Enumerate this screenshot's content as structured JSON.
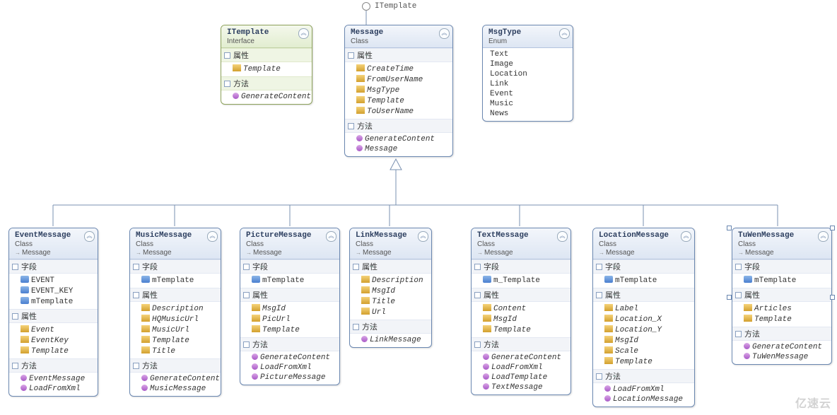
{
  "interface_label": "ITemplate",
  "sections": {
    "properties": "属性",
    "methods": "方法",
    "fields": "字段"
  },
  "watermark": "亿速云",
  "classes": {
    "ITemplate": {
      "name": "ITemplate",
      "sub": "Interface",
      "properties": [
        "Template"
      ],
      "methods": [
        "GenerateContent"
      ]
    },
    "Message": {
      "name": "Message",
      "sub": "Class",
      "properties": [
        "CreateTime",
        "FromUserName",
        "MsgType",
        "Template",
        "ToUserName"
      ],
      "methods": [
        "GenerateContent",
        "Message"
      ]
    },
    "MsgType": {
      "name": "MsgType",
      "sub": "Enum",
      "values": [
        "Text",
        "Image",
        "Location",
        "Link",
        "Event",
        "Music",
        "News"
      ]
    },
    "EventMessage": {
      "name": "EventMessage",
      "sub": "Class",
      "inherits": "Message",
      "fields": [
        "EVENT",
        "EVENT_KEY",
        "mTemplate"
      ],
      "properties": [
        "Event",
        "EventKey",
        "Template"
      ],
      "methods": [
        "EventMessage",
        "LoadFromXml"
      ]
    },
    "MusicMessage": {
      "name": "MusicMessage",
      "sub": "Class",
      "inherits": "Message",
      "fields": [
        "mTemplate"
      ],
      "properties": [
        "Description",
        "HQMusicUrl",
        "MusicUrl",
        "Template",
        "Title"
      ],
      "methods": [
        "GenerateContent",
        "MusicMessage"
      ]
    },
    "PictureMessage": {
      "name": "PictureMessage",
      "sub": "Class",
      "inherits": "Message",
      "fields": [
        "mTemplate"
      ],
      "properties": [
        "MsgId",
        "PicUrl",
        "Template"
      ],
      "methods": [
        "GenerateContent",
        "LoadFromXml",
        "PictureMessage"
      ]
    },
    "LinkMessage": {
      "name": "LinkMessage",
      "sub": "Class",
      "inherits": "Message",
      "properties": [
        "Description",
        "MsgId",
        "Title",
        "Url"
      ],
      "methods": [
        "LinkMessage"
      ]
    },
    "TextMessage": {
      "name": "TextMessage",
      "sub": "Class",
      "inherits": "Message",
      "fields": [
        "m_Template"
      ],
      "properties": [
        "Content",
        "MsgId",
        "Template"
      ],
      "methods": [
        "GenerateContent",
        "LoadFromXml",
        "LoadTemplate",
        "TextMessage"
      ]
    },
    "LocationMessage": {
      "name": "LocationMessage",
      "sub": "Class",
      "inherits": "Message",
      "fields": [
        "mTemplate"
      ],
      "properties": [
        "Label",
        "Location_X",
        "Location_Y",
        "MsgId",
        "Scale",
        "Template"
      ],
      "methods": [
        "LoadFromXml",
        "LocationMessage"
      ]
    },
    "TuWenMessage": {
      "name": "TuWenMessage",
      "sub": "Class",
      "inherits": "Message",
      "fields": [
        "mTemplate"
      ],
      "properties": [
        "Articles",
        "Template"
      ],
      "methods": [
        "GenerateContent",
        "TuWenMessage"
      ]
    }
  },
  "chart_data": {
    "type": "class-diagram",
    "interface_realization": {
      "implementor": "Message",
      "interface": "ITemplate"
    },
    "generalizations": [
      {
        "parent": "Message",
        "child": "EventMessage"
      },
      {
        "parent": "Message",
        "child": "MusicMessage"
      },
      {
        "parent": "Message",
        "child": "PictureMessage"
      },
      {
        "parent": "Message",
        "child": "LinkMessage"
      },
      {
        "parent": "Message",
        "child": "TextMessage"
      },
      {
        "parent": "Message",
        "child": "LocationMessage"
      },
      {
        "parent": "Message",
        "child": "TuWenMessage"
      }
    ],
    "enum_values": {
      "MsgType": [
        "Text",
        "Image",
        "Location",
        "Link",
        "Event",
        "Music",
        "News"
      ]
    }
  }
}
